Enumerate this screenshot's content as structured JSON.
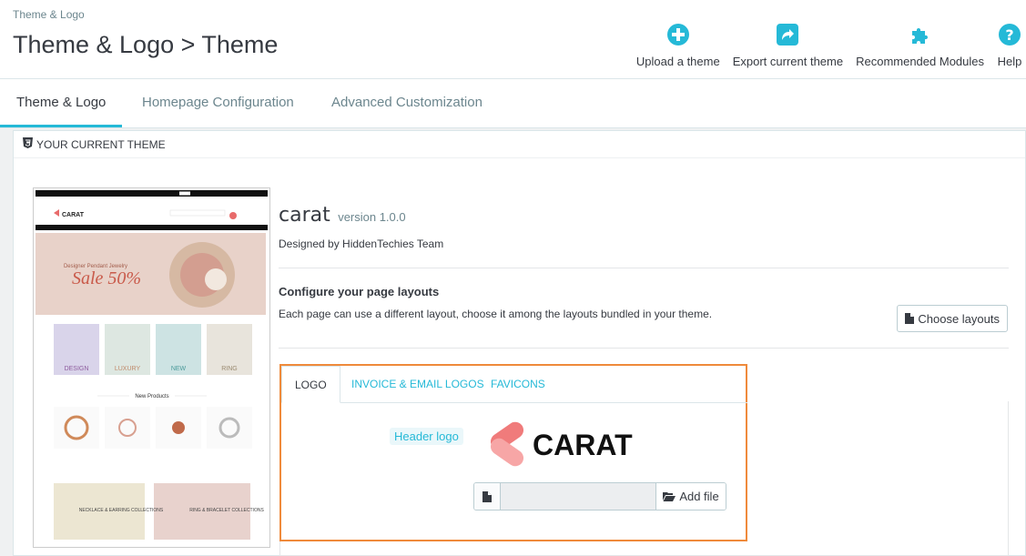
{
  "header": {
    "breadcrumb": "Theme & Logo",
    "title": "Theme & Logo > Theme",
    "toolbar": [
      {
        "label": "Upload a theme",
        "icon": "plus-circle-icon"
      },
      {
        "label": "Export current theme",
        "icon": "share-icon"
      },
      {
        "label": "Recommended Modules",
        "icon": "puzzle-icon"
      },
      {
        "label": "Help",
        "icon": "help-icon"
      }
    ]
  },
  "tabs": [
    {
      "label": "Theme & Logo",
      "active": true
    },
    {
      "label": "Homepage Configuration",
      "active": false
    },
    {
      "label": "Advanced Customization",
      "active": false
    }
  ],
  "panel": {
    "heading": "YOUR CURRENT THEME",
    "theme_name": "carat",
    "theme_version": "version 1.0.0",
    "designed_by": "Designed by HiddenTechies Team",
    "layouts_title": "Configure your page layouts",
    "layouts_desc": "Each page can use a different layout, choose it among the layouts bundled in your theme.",
    "choose_layouts": "Choose layouts"
  },
  "preview": {
    "brand": "CARAT",
    "banner_small": "Designer Pendant Jewelry",
    "banner_big": "Sale 50%",
    "categories": [
      "DESIGN",
      "LUXURY",
      "NEW",
      "RING"
    ],
    "new_products": "New Products",
    "collections": [
      "NECKLACE & EARRING COLLECTIONS",
      "RING & BRACELET COLLECTIONS"
    ]
  },
  "logo_section": {
    "tabs": [
      "LOGO",
      "INVOICE & EMAIL LOGOS",
      "FAVICONS"
    ],
    "header_logo_label": "Header logo",
    "logo_text": "CARAT",
    "add_file": "Add file"
  },
  "colors": {
    "accent": "#25b9d7",
    "highlight_border": "#ef8a3b",
    "logo_pink": "#f07b7b"
  }
}
